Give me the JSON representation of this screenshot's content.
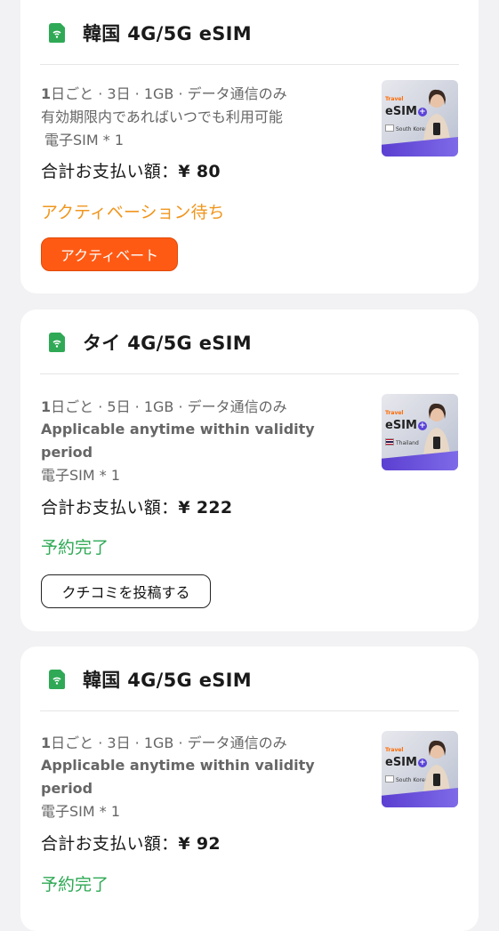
{
  "colors": {
    "accent_green": "#2fa955",
    "pending_orange": "#f0961e",
    "button_orange": "#ff5a14"
  },
  "orders": [
    {
      "title": "韓国 4G/5G eSIM",
      "detail_prefix": "1",
      "detail_line1": "日ごと · 3日 · 1GB · データ通信のみ",
      "detail_line2": "有効期限内であればいつでも利用可能",
      "detail_line3": "電子SIM * 1",
      "total_label": "合計お支払い額：",
      "total_amount": "¥ 80",
      "status": "アクティベーション待ち",
      "status_color": "#f0961e",
      "button_label": "アクティベート",
      "thumb": {
        "brand_small": "Travel",
        "brand": "eSIM",
        "country": "South Korea",
        "icon": "korea-flag-icon"
      }
    },
    {
      "title": "タイ 4G/5G eSIM",
      "detail_prefix": "1",
      "detail_line1": "日ごと · 5日 · 1GB · データ通信のみ",
      "detail_line2": "Applicable anytime within validity",
      "detail_line2b": "period",
      "detail_line3": "電子SIM * 1",
      "total_label": "合計お支払い額：",
      "total_amount": "¥ 222",
      "status": "予約完了",
      "status_color": "#2fa955",
      "button_label": "クチコミを投稿する",
      "thumb": {
        "brand_small": "Travel",
        "brand": "eSIM",
        "country": "Thailand",
        "icon": "thailand-flag-icon"
      }
    },
    {
      "title": "韓国 4G/5G eSIM",
      "detail_prefix": "1",
      "detail_line1": "日ごと · 3日 · 1GB · データ通信のみ",
      "detail_line2": "Applicable anytime within validity",
      "detail_line2b": "period",
      "detail_line3": "電子SIM * 1",
      "total_label": "合計お支払い額：",
      "total_amount": "¥ 92",
      "status": "予約完了",
      "status_color": "#2fa955",
      "thumb": {
        "brand_small": "Travel",
        "brand": "eSIM",
        "country": "South Korea",
        "icon": "korea-flag-icon"
      }
    }
  ]
}
